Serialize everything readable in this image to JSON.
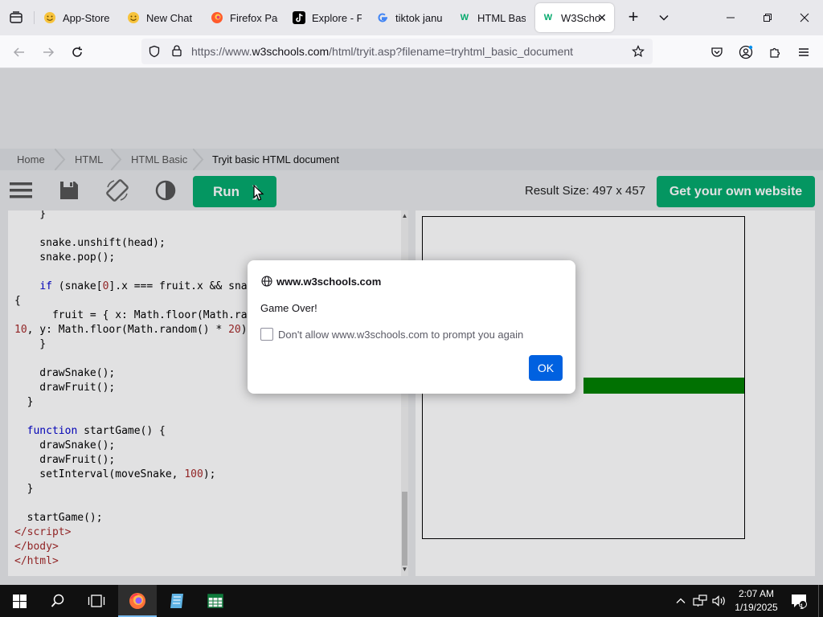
{
  "browser": {
    "tabs": [
      {
        "title": "App-Store",
        "icon": "smiley-emoji-icon",
        "active": false
      },
      {
        "title": "New Chat",
        "icon": "smiley-emoji-icon",
        "active": false
      },
      {
        "title": "Firefox Pag",
        "icon": "firefox-icon",
        "active": false
      },
      {
        "title": "Explore - Fi",
        "icon": "tiktok-icon",
        "active": false
      },
      {
        "title": "tiktok janu",
        "icon": "google-icon",
        "active": false
      },
      {
        "title": "HTML Basi",
        "icon": "w3schools-icon",
        "active": false
      },
      {
        "title": "W3Scho",
        "icon": "w3schools-icon",
        "active": true
      }
    ],
    "url_prefix": "https://www.",
    "url_domain": "w3schools.com",
    "url_rest": "/html/tryit.asp?filename=tryhtml_basic_document"
  },
  "page": {
    "breadcrumbs": [
      "Home",
      "HTML",
      "HTML Basic",
      "Tryit basic HTML document"
    ],
    "toolbar": {
      "run_label": "Run",
      "run_arrow": "❯",
      "result_size": "Result Size: 497 x 457",
      "own_website_label": "Get your own website"
    }
  },
  "dialog": {
    "origin": "www.w3schools.com",
    "message": "Game Over!",
    "checkbox_label": "Don't allow www.w3schools.com to prompt you again",
    "ok_label": "OK"
  },
  "taskbar": {
    "time": "2:07 AM",
    "date": "1/19/2025",
    "notification_count": "1"
  },
  "colors": {
    "accent_green": "#04aa6d",
    "snake_green": "#008000",
    "dialog_button_blue": "#0061e0"
  }
}
